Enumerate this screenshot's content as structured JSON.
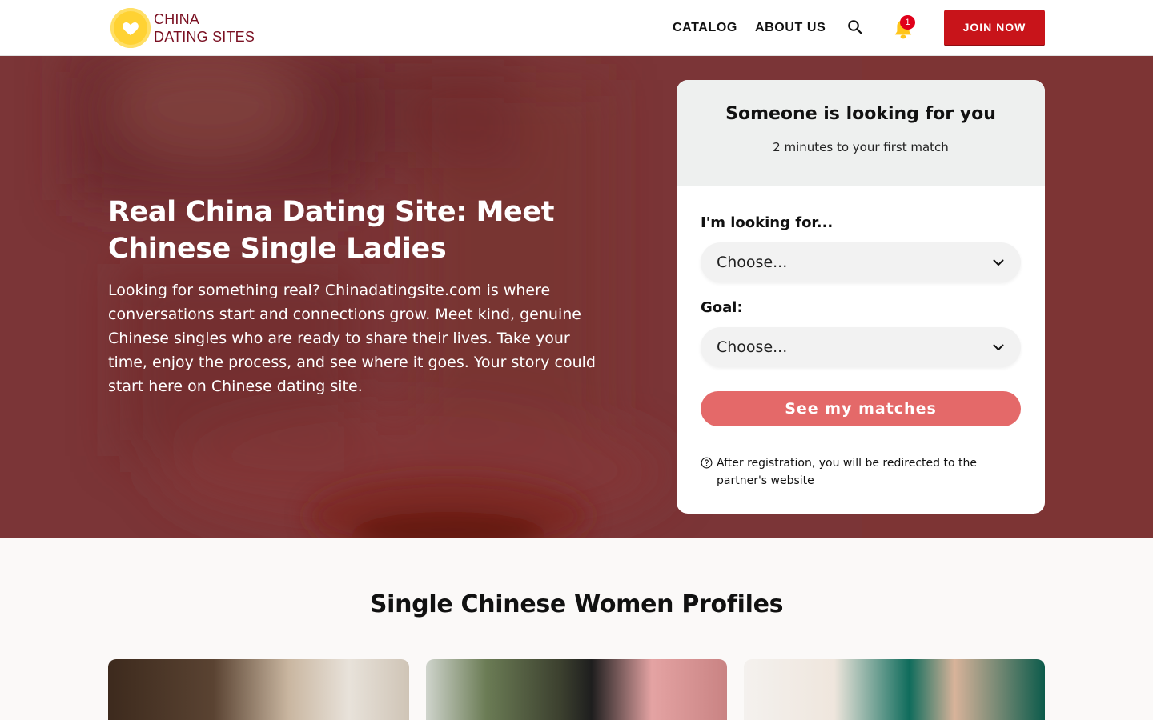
{
  "header": {
    "logo_line1": "CHINA",
    "logo_line2": "DATING SITES",
    "nav": {
      "catalog": "CATALOG",
      "about": "ABOUT US"
    },
    "notification_count": "1",
    "join_label": "JOIN NOW"
  },
  "hero": {
    "title": "Real China Dating Site: Meet Chinese Single Ladies",
    "text": "Looking for something real? Chinadatingsite.com is where conversations start and connections grow. Meet kind, genuine Chinese singles who are ready to share their lives. Take your time, enjoy the process, and see where it goes. Your story could start here on Chinese dating site."
  },
  "form": {
    "title": "Someone is looking for you",
    "subtitle": "2 minutes to your first match",
    "looking_for_label": "I'm looking for...",
    "looking_for_value": "Choose...",
    "goal_label": "Goal:",
    "goal_value": "Choose...",
    "submit_label": "See my matches",
    "note": "After registration, you will be redirected to the partner's website"
  },
  "profiles": {
    "title": "Single Chinese Women Profiles"
  },
  "colors": {
    "hero_bg": "#7b3537",
    "join_button": "#c8141a",
    "cta_button": "#e46969",
    "logo_yellow": "#ffd233",
    "logo_text": "#7a1022"
  },
  "icons": {
    "logo": "heart-icon",
    "search": "search-icon",
    "bell": "bell-icon",
    "select": "chevron-down-icon",
    "note": "question-circle-icon"
  }
}
